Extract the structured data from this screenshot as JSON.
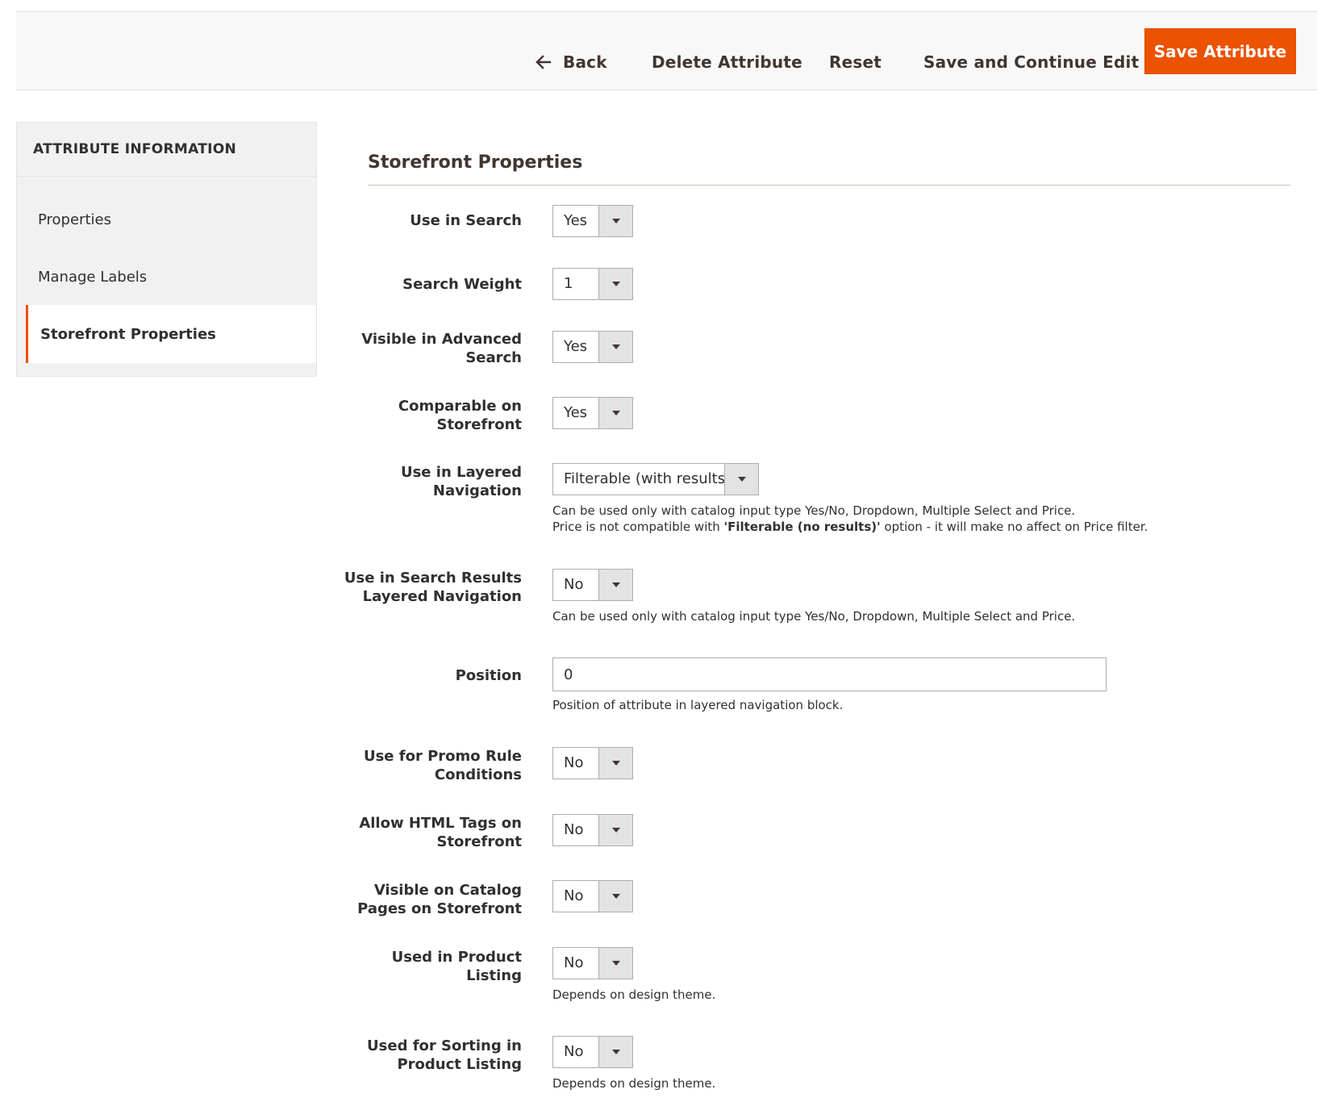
{
  "toolbar": {
    "back_label": "Back",
    "delete_label": "Delete Attribute",
    "reset_label": "Reset",
    "save_continue_label": "Save and Continue Edit",
    "save_label": "Save Attribute"
  },
  "sidebar": {
    "title": "ATTRIBUTE INFORMATION",
    "items": [
      {
        "label": "Properties",
        "active": false
      },
      {
        "label": "Manage Labels",
        "active": false
      },
      {
        "label": "Storefront Properties",
        "active": true
      }
    ]
  },
  "main": {
    "section_title": "Storefront Properties",
    "fields": {
      "use_in_search": {
        "label": "Use in Search",
        "value": "Yes"
      },
      "search_weight": {
        "label": "Search Weight",
        "value": "1"
      },
      "visible_advanced_search": {
        "label_line1": "Visible in Advanced",
        "label_line2": "Search",
        "value": "Yes"
      },
      "comparable_storefront": {
        "label_line1": "Comparable on",
        "label_line2": "Storefront",
        "value": "Yes"
      },
      "layered_navigation": {
        "label_line1": "Use in Layered",
        "label_line2": "Navigation",
        "value": "Filterable (with results)",
        "note_line1": "Can be used only with catalog input type Yes/No, Dropdown, Multiple Select and Price.",
        "note_line2_prefix": "Price is not compatible with ",
        "note_line2_bold": "'Filterable (no results)'",
        "note_line2_suffix": " option - it will make no affect on Price filter."
      },
      "search_results_layered": {
        "label_line1": "Use in Search Results",
        "label_line2": "Layered Navigation",
        "value": "No",
        "note": "Can be used only with catalog input type Yes/No, Dropdown, Multiple Select and Price."
      },
      "position": {
        "label": "Position",
        "value": "0",
        "note": "Position of attribute in layered navigation block."
      },
      "promo_rule": {
        "label_line1": "Use for Promo Rule",
        "label_line2": "Conditions",
        "value": "No"
      },
      "html_tags": {
        "label_line1": "Allow HTML Tags on",
        "label_line2": "Storefront",
        "value": "No"
      },
      "visible_catalog_pages": {
        "label_line1": "Visible on Catalog",
        "label_line2": "Pages on Storefront",
        "value": "No"
      },
      "product_listing": {
        "label_line1": "Used in Product",
        "label_line2": "Listing",
        "value": "No",
        "note": "Depends on design theme."
      },
      "sorting_listing": {
        "label_line1": "Used for Sorting in",
        "label_line2": "Product Listing",
        "value": "No",
        "note": "Depends on design theme."
      }
    }
  },
  "colors": {
    "accent": "#eb5202",
    "header_bg": "#f8f8f8",
    "sidebar_bg": "#f1f1f1",
    "select_arrow_bg": "#e3e3e3"
  }
}
